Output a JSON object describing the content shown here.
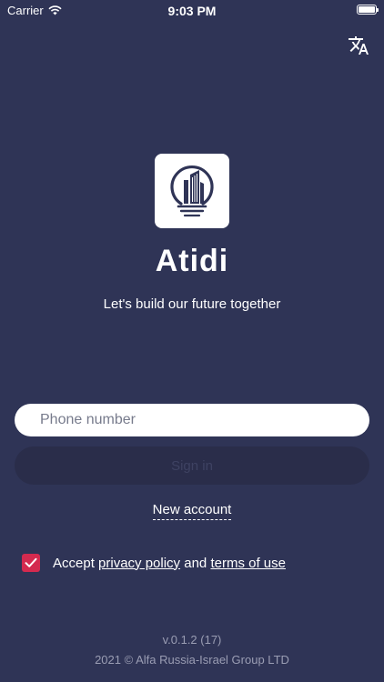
{
  "status_bar": {
    "carrier": "Carrier",
    "time": "9:03 PM"
  },
  "app": {
    "name": "Atidi",
    "tagline": "Let's build our future together"
  },
  "login": {
    "phone_placeholder": "Phone number",
    "signin_label": "Sign in",
    "new_account_label": "New account"
  },
  "terms": {
    "checked": true,
    "prefix": "Accept",
    "privacy_link": "privacy policy",
    "conjunction": "and",
    "terms_link": "terms of use"
  },
  "footer": {
    "version": "v.0.1.2 (17)",
    "copyright": "2021 © Alfa Russia-Israel Group LTD"
  },
  "colors": {
    "background": "#2f3456",
    "checkbox": "#d42a4f",
    "logo_ink": "#2f3456"
  },
  "icons": [
    "wifi-icon",
    "battery-icon",
    "translate-icon",
    "app-logo-icon",
    "checkmark-icon"
  ]
}
